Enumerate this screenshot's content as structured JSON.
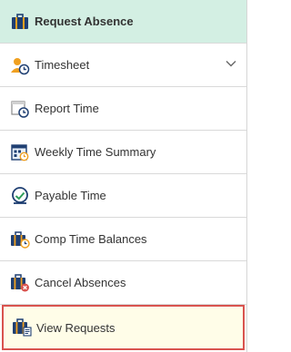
{
  "menu": {
    "items": [
      {
        "label": "Request Absence",
        "icon": "briefcase-icon"
      },
      {
        "label": "Timesheet",
        "icon": "person-clock-icon"
      },
      {
        "label": "Report Time",
        "icon": "calendar-clock-icon"
      },
      {
        "label": "Weekly Time Summary",
        "icon": "calendar-grid-icon"
      },
      {
        "label": "Payable Time",
        "icon": "payable-clock-icon"
      },
      {
        "label": "Comp Time Balances",
        "icon": "briefcase-clock-icon"
      },
      {
        "label": "Cancel Absences",
        "icon": "briefcase-cancel-icon"
      },
      {
        "label": "View Requests",
        "icon": "briefcase-list-icon"
      }
    ]
  },
  "colors": {
    "active_bg": "#d3efe3",
    "highlight_bg": "#fffde8",
    "highlight_border": "#d9534f",
    "icon_navy": "#1f3f72",
    "icon_orange": "#f0a020"
  }
}
